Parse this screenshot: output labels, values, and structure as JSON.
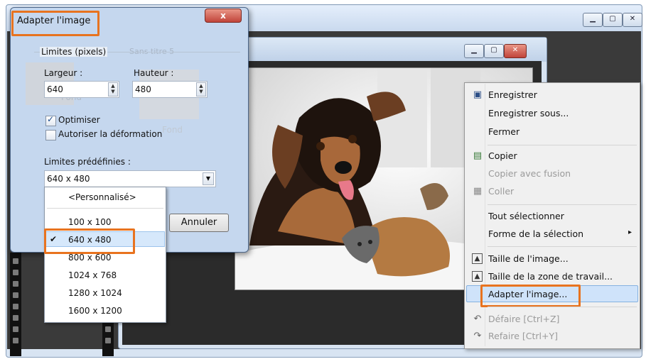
{
  "dialog": {
    "title": "Adapter l'image",
    "group_label": "Limites (pixels)",
    "width_label": "Largeur :",
    "width_value": "640",
    "height_label": "Hauteur :",
    "height_value": "480",
    "optimize_label": "Optimiser",
    "optimize_checked": true,
    "allow_distort_label": "Autoriser la déformation",
    "allow_distort_checked": false,
    "presets_label": "Limites prédéfinies :",
    "presets_value": "640 x 480",
    "cancel_label": "Annuler",
    "close_glyph": "x"
  },
  "dropdown": {
    "options": [
      "<Personnalisé>",
      "100 x 100",
      "640 x 480",
      "800 x 600",
      "1024 x 768",
      "1280 x 1024",
      "1600 x 1200"
    ],
    "selected": "640 x 480",
    "check_glyph": "✔"
  },
  "background_window": {
    "title_ghost": "Sans titre 5",
    "thumb_label_1": "Fond",
    "thumb_label_2": "Fond"
  },
  "context_menu": {
    "items": [
      {
        "label": "Enregistrer",
        "icon": "save-icon",
        "disabled": false
      },
      {
        "label": "Enregistrer sous...",
        "icon": "",
        "disabled": false
      },
      {
        "label": "Fermer",
        "icon": "",
        "disabled": false
      },
      {
        "label": "Copier",
        "icon": "copy-icon",
        "disabled": false
      },
      {
        "label": "Copier avec fusion",
        "icon": "",
        "disabled": true
      },
      {
        "label": "Coller",
        "icon": "paste-icon",
        "disabled": true
      },
      {
        "label": "Tout sélectionner",
        "icon": "",
        "disabled": false
      },
      {
        "label": "Forme de la sélection",
        "icon": "",
        "disabled": false,
        "submenu": true
      },
      {
        "label": "Taille de l'image...",
        "icon": "image-size-icon",
        "disabled": false
      },
      {
        "label": "Taille de la zone de travail...",
        "icon": "canvas-size-icon",
        "disabled": false
      },
      {
        "label": "Adapter l'image...",
        "icon": "",
        "disabled": false,
        "highlighted": true
      },
      {
        "label": "Défaire [Ctrl+Z]",
        "icon": "undo-icon",
        "disabled": true
      },
      {
        "label": "Refaire [Ctrl+Y]",
        "icon": "redo-icon",
        "disabled": true
      }
    ],
    "submenu_glyph": "▸"
  },
  "colors": {
    "highlight_orange": "#e8731f",
    "menu_selected": "#cfe3fa",
    "list_selected": "#d6e8fb"
  }
}
